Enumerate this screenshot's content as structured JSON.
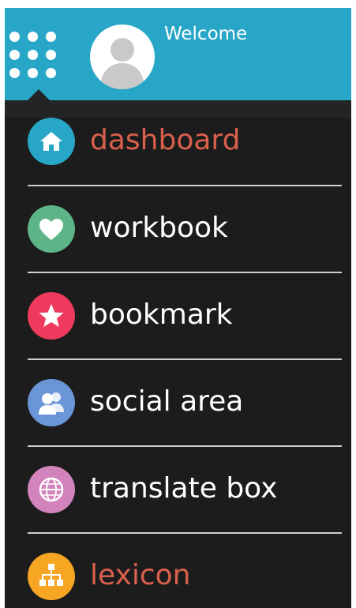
{
  "header": {
    "welcome_text": "Welcome",
    "apps_icon": "apps-grid-icon",
    "avatar_icon": "user-avatar-icon"
  },
  "colors": {
    "header_bg": "#27a6c7",
    "panel_bg": "#1d1c1c",
    "label_default": "#ffffff",
    "label_highlight": "#d9604c"
  },
  "menu": {
    "items": [
      {
        "label": "dashboard",
        "icon": "home-icon",
        "icon_color": "#27a6c7",
        "highlighted": true
      },
      {
        "label": "workbook",
        "icon": "heart-icon",
        "icon_color": "#5db587",
        "highlighted": false
      },
      {
        "label": "bookmark",
        "icon": "star-icon",
        "icon_color": "#ee3a5c",
        "highlighted": false
      },
      {
        "label": "social area",
        "icon": "users-icon",
        "icon_color": "#6a96d8",
        "highlighted": false
      },
      {
        "label": "translate box",
        "icon": "globe-icon",
        "icon_color": "#d383bb",
        "highlighted": false
      },
      {
        "label": "lexicon",
        "icon": "sitemap-icon",
        "icon_color": "#f6a623",
        "highlighted": true
      }
    ]
  }
}
